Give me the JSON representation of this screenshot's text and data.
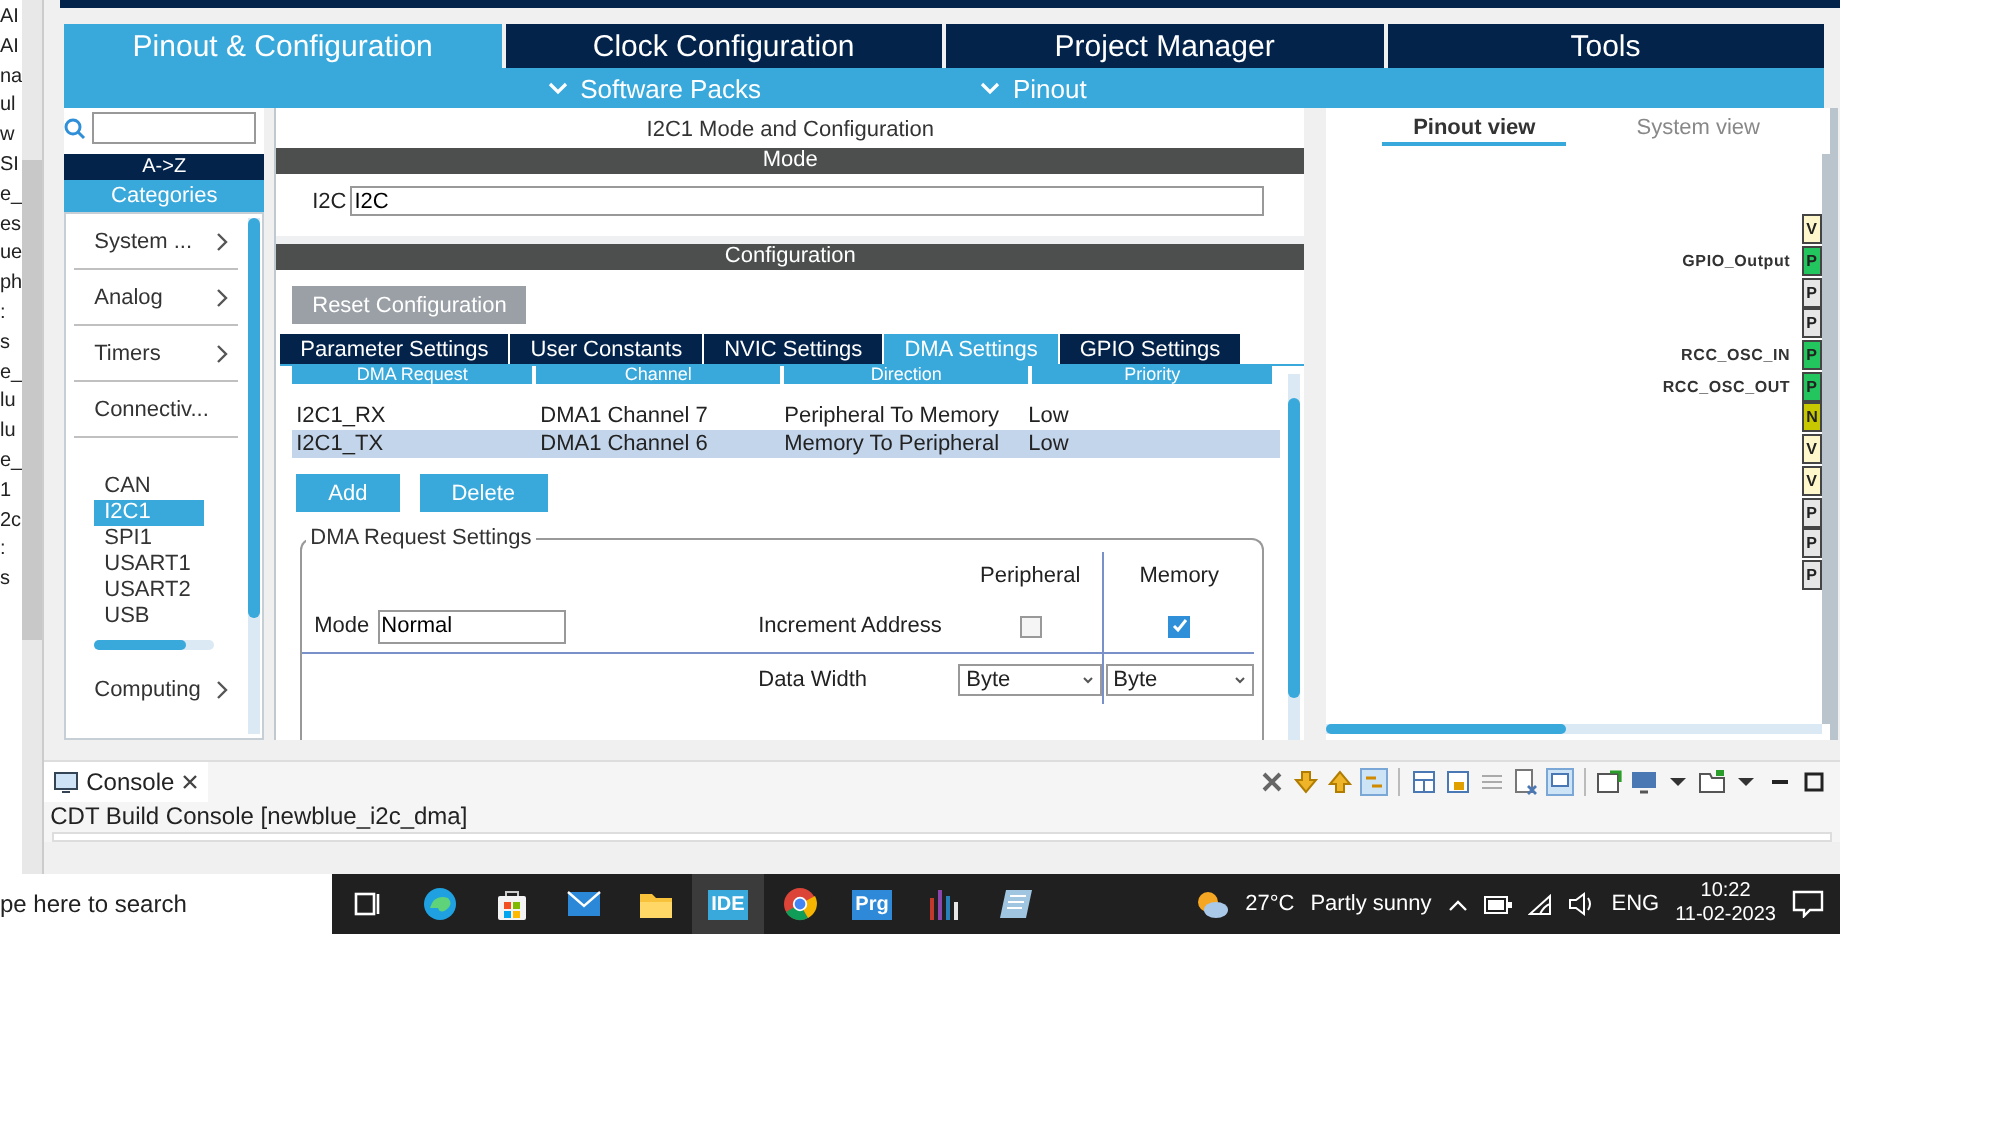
{
  "left_strip": {
    "fragments": [
      "AI",
      "AI",
      "na",
      "ul",
      "w",
      "SI",
      "e_",
      "es",
      "ue",
      "ph",
      ":",
      "s",
      "e_",
      "lu",
      "lu",
      "e_",
      "1",
      "2c",
      ":",
      "s"
    ]
  },
  "main_tabs": [
    {
      "label": "Pinout & Configuration",
      "selected": true
    },
    {
      "label": "Clock Configuration",
      "selected": false
    },
    {
      "label": "Project Manager",
      "selected": false
    },
    {
      "label": "Tools",
      "selected": false
    }
  ],
  "sub_menu": [
    {
      "label": "Software Packs"
    },
    {
      "label": "Pinout"
    }
  ],
  "category_panel": {
    "sort_label": "A->Z",
    "categories_label": "Categories",
    "categories": [
      {
        "label": "System ...",
        "expanded": false
      },
      {
        "label": "Analog",
        "expanded": false
      },
      {
        "label": "Timers",
        "expanded": false
      },
      {
        "label": "Connectiv...",
        "expanded": true,
        "children": [
          {
            "label": "CAN",
            "selected": false
          },
          {
            "label": "I2C1",
            "selected": true
          },
          {
            "label": "SPI1",
            "selected": false
          },
          {
            "label": "USART1",
            "selected": false
          },
          {
            "label": "USART2",
            "selected": false
          },
          {
            "label": "USB",
            "selected": false
          }
        ]
      },
      {
        "label": "Computing",
        "expanded": false
      }
    ]
  },
  "config_panel": {
    "title": "I2C1 Mode and Configuration",
    "mode_header": "Mode",
    "mode_label": "I2C",
    "mode_value": "I2C",
    "config_header": "Configuration",
    "reset_button": "Reset Configuration",
    "tabs": [
      {
        "label": "Parameter Settings",
        "selected": false
      },
      {
        "label": "User Constants",
        "selected": false
      },
      {
        "label": "NVIC Settings",
        "selected": false
      },
      {
        "label": "DMA Settings",
        "selected": true
      },
      {
        "label": "GPIO Settings",
        "selected": false
      }
    ],
    "table": {
      "columns": [
        "DMA Request",
        "Channel",
        "Direction",
        "Priority"
      ],
      "rows": [
        {
          "cells": [
            "I2C1_RX",
            "DMA1 Channel 7",
            "Peripheral To Memory",
            "Low"
          ],
          "selected": false
        },
        {
          "cells": [
            "I2C1_TX",
            "DMA1 Channel 6",
            "Memory To Peripheral",
            "Low"
          ],
          "selected": true
        }
      ]
    },
    "buttons": [
      "Add",
      "Delete"
    ],
    "request_settings": {
      "title": "DMA Request Settings",
      "mode_label": "Mode",
      "mode_value": "Normal",
      "col_peripheral": "Peripheral",
      "col_memory": "Memory",
      "increment_label": "Increment Address",
      "increment_peripheral": false,
      "increment_memory": true,
      "width_label": "Data Width",
      "width_peripheral": "Byte",
      "width_memory": "Byte"
    }
  },
  "pinout_panel": {
    "tabs": [
      {
        "label": "Pinout view",
        "selected": true
      },
      {
        "label": "System view",
        "selected": false
      }
    ],
    "pins": [
      {
        "letter": "V",
        "color": "#fff7cc"
      },
      {
        "letter": "P",
        "color": "#22c55e",
        "label": "GPIO_Output"
      },
      {
        "letter": "P",
        "color": "#e6e6e6"
      },
      {
        "letter": "P",
        "color": "#e6e6e6"
      },
      {
        "letter": "P",
        "color": "#22c55e",
        "label": "RCC_OSC_IN"
      },
      {
        "letter": "P",
        "color": "#22c55e",
        "label": "RCC_OSC_OUT"
      },
      {
        "letter": "N",
        "color": "#c8c800"
      },
      {
        "letter": "V",
        "color": "#fff7cc"
      },
      {
        "letter": "V",
        "color": "#fff7cc"
      },
      {
        "letter": "P",
        "color": "#e6e6e6"
      },
      {
        "letter": "P",
        "color": "#e6e6e6"
      },
      {
        "letter": "P",
        "color": "#e6e6e6"
      }
    ]
  },
  "console": {
    "tab": "Console",
    "text": "CDT Build Console [newblue_i2c_dma]"
  },
  "taskbar": {
    "search": "pe here to search",
    "apps": [
      {
        "kind": "taskview",
        "selected": false
      },
      {
        "kind": "browser",
        "selected": false
      },
      {
        "kind": "store",
        "selected": false
      },
      {
        "kind": "mail",
        "selected": false
      },
      {
        "kind": "folder",
        "selected": false
      },
      {
        "kind": "ide",
        "label": "IDE",
        "selected": true
      },
      {
        "kind": "chrome",
        "selected": false
      },
      {
        "kind": "prg",
        "label": "Prg",
        "selected": false
      },
      {
        "kind": "chart",
        "selected": false
      },
      {
        "kind": "notes",
        "selected": false
      }
    ],
    "weather": "27°C",
    "weather_text": "Partly sunny",
    "language": "ENG",
    "time": "10:22",
    "date": "11-02-2023"
  }
}
